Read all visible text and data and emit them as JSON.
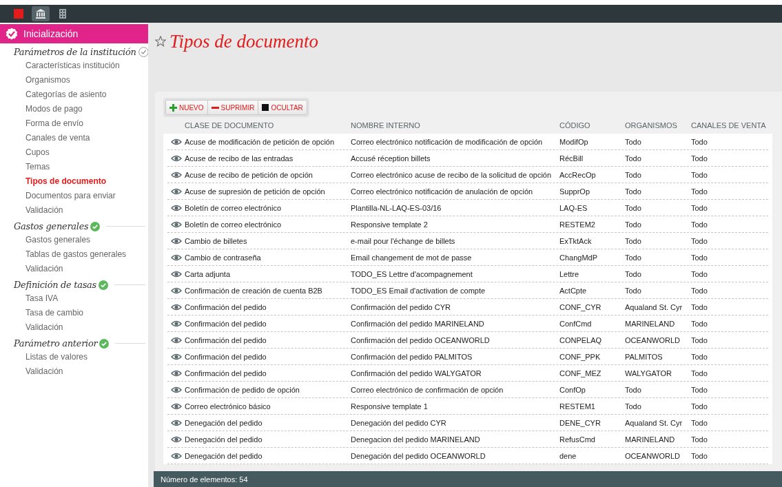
{
  "topbar": {
    "icons": [
      {
        "kind": "square",
        "selected": false
      },
      {
        "kind": "bank",
        "selected": true
      },
      {
        "kind": "building",
        "selected": false
      }
    ]
  },
  "sidebar": {
    "header": {
      "label": "Inicialización"
    },
    "sections": [
      {
        "title": "Parámetros de la institución",
        "done": false,
        "items": [
          {
            "label": "Características institución",
            "selected": false
          },
          {
            "label": "Organismos",
            "selected": false
          },
          {
            "label": "Categorías de asiento",
            "selected": false
          },
          {
            "label": "Modos de pago",
            "selected": false
          },
          {
            "label": "Forma de envío",
            "selected": false
          },
          {
            "label": "Canales de venta",
            "selected": false
          },
          {
            "label": "Cupos",
            "selected": false
          },
          {
            "label": "Temas",
            "selected": false
          },
          {
            "label": "Tipos de documento",
            "selected": true
          },
          {
            "label": "Documentos para enviar",
            "selected": false
          },
          {
            "label": "Validación",
            "selected": false
          }
        ]
      },
      {
        "title": "Gastos generales",
        "done": true,
        "items": [
          {
            "label": "Gastos generales",
            "selected": false
          },
          {
            "label": "Tablas de gastos generales",
            "selected": false
          },
          {
            "label": "Validación",
            "selected": false
          }
        ]
      },
      {
        "title": "Definición de tasas",
        "done": true,
        "items": [
          {
            "label": "Tasa IVA",
            "selected": false
          },
          {
            "label": "Tasa de cambio",
            "selected": false
          },
          {
            "label": "Validación",
            "selected": false
          }
        ]
      },
      {
        "title": "Parámetro anterior",
        "done": true,
        "items": [
          {
            "label": "Listas de valores",
            "selected": false
          },
          {
            "label": "Validación",
            "selected": false
          }
        ]
      }
    ]
  },
  "page": {
    "title": "Tipos de documento",
    "favorite": false
  },
  "toolbar": [
    {
      "kind": "add",
      "label": "NUEVO"
    },
    {
      "kind": "delete",
      "label": "SUPRIMIR"
    },
    {
      "kind": "hide",
      "label": "OCULTAR"
    }
  ],
  "table": {
    "columns": [
      "CLASE DE DOCUMENTO",
      "NOMBRE INTERNO",
      "CÓDIGO",
      "ORGANISMOS",
      "CANALES DE VENTA"
    ],
    "rows": [
      [
        "Acuse de modificación de petición de opción",
        "Correo electrónico notificación de modificación de opción",
        "ModifOp",
        "Todo",
        "Todo"
      ],
      [
        "Acuse de recibo de las entradas",
        "Accusé réception billets",
        "RécBill",
        "Todo",
        "Todo"
      ],
      [
        "Acuse de recibo de petición de opción",
        "Correo electrónico acuse de recibo de la solicitud de opción",
        "AccRecOp",
        "Todo",
        "Todo"
      ],
      [
        "Acuse de supresión de petición de opción",
        "Correo electrónico notificación de anulación de opción",
        "SupprOp",
        "Todo",
        "Todo"
      ],
      [
        "Boletín de correo electrónico",
        "Plantilla-NL-LAQ-ES-03/16",
        "LAQ-ES",
        "Todo",
        "Todo"
      ],
      [
        "Boletín de correo electrónico",
        "Responsive template 2",
        "RESTEM2",
        "Todo",
        "Todo"
      ],
      [
        "Cambio de billetes",
        "e-mail pour l'échange de billets",
        "ExTktAck",
        "Todo",
        "Todo"
      ],
      [
        "Cambio de contraseña",
        "Email changement de mot de passe",
        "ChangMdP",
        "Todo",
        "Todo"
      ],
      [
        "Carta adjunta",
        "TODO_ES Lettre d'acompagnement",
        "Lettre",
        "Todo",
        "Todo"
      ],
      [
        "Confirmación de creación de cuenta B2B",
        "TODO_ES Email d'activation de compte",
        "ActCpte",
        "Todo",
        "Todo"
      ],
      [
        "Confirmación del pedido",
        "Confirmación del pedido CYR",
        "CONF_CYR",
        "Aqualand St. Cyr",
        "Todo"
      ],
      [
        "Confirmación del pedido",
        "Confirmación del pedido MARINELAND",
        "ConfCmd",
        "MARINELAND",
        "Todo"
      ],
      [
        "Confirmación del pedido",
        "Confirmación del pedido OCEANWORLD",
        "CONPELAQ",
        "OCEANWORLD",
        "Todo"
      ],
      [
        "Confirmación del pedido",
        "Confirmación del pedido PALMITOS",
        "CONF_PPK",
        "PALMITOS",
        "Todo"
      ],
      [
        "Confirmación del pedido",
        "Confirmación del pedido WALYGATOR",
        "CONF_MEZ",
        "WALYGATOR",
        "Todo"
      ],
      [
        "Confirmación de pedido de opción",
        "Correo electrónico de confirmación de opción",
        "ConfOp",
        "Todo",
        "Todo"
      ],
      [
        "Correo electrónico básico",
        "Responsive template 1",
        "RESTEM1",
        "Todo",
        "Todo"
      ],
      [
        "Denegación del pedido",
        "Denegación del pedido CYR",
        "DENE_CYR",
        "Aqualand St. Cyr",
        "Todo"
      ],
      [
        "Denegación del pedido",
        "Denegacion del pedido MARINELAND",
        "RefusCmd",
        "MARINELAND",
        "Todo"
      ],
      [
        "Denegación del pedido",
        "Denegación del pedido OCEANWORLD",
        "dene",
        "OCEANWORLD",
        "Todo"
      ]
    ]
  },
  "footer": {
    "count": "Número de elementos: 54"
  }
}
